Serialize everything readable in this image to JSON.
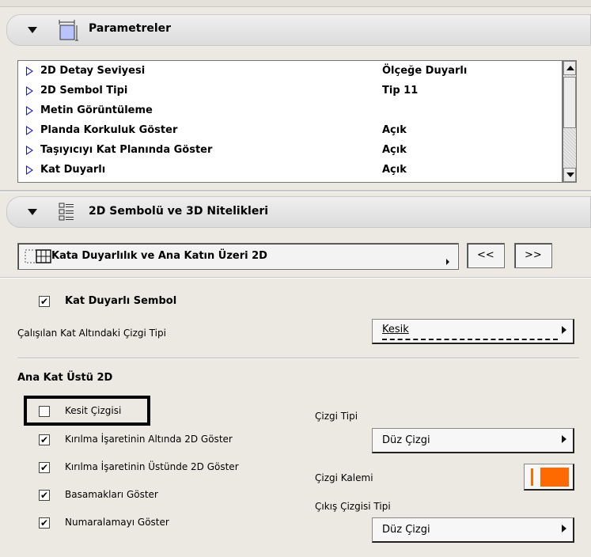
{
  "params_section": {
    "title": "Parametreler"
  },
  "param_list": [
    {
      "name": "2D Detay Seviyesi",
      "value": "Ölçeğe Duyarlı"
    },
    {
      "name": "2D Sembol Tipi",
      "value": "Tip 11"
    },
    {
      "name": "Metin Görüntüleme",
      "value": ""
    },
    {
      "name": "Planda Korkuluk Göster",
      "value": "Açık"
    },
    {
      "name": "Taşıyıcıyı Kat Planında Göster",
      "value": "Açık"
    },
    {
      "name": "Kat Duyarlı",
      "value": "Açık"
    }
  ],
  "symbol_section": {
    "title": "2D Sembolü ve 3D Nitelikleri"
  },
  "page_selector": {
    "label": "Kata Duyarlılık ve Ana Katın Üzeri 2D",
    "prev_label": "<<",
    "next_label": ">>"
  },
  "kat_duyarli": {
    "label": "Kat Duyarlı Sembol",
    "checked": "✔"
  },
  "line_type_below": {
    "label": "Çalışılan Kat Altındaki Çizgi Tipi",
    "value": "Kesik"
  },
  "ana_kat": {
    "heading": "Ana Kat Üstü 2D",
    "options": [
      {
        "label": "Kesit Çizgisi",
        "checked": ""
      },
      {
        "label": "Kırılma İşaretinin Altında 2D Göster",
        "checked": "✔"
      },
      {
        "label": "Kırılma İşaretinin Üstünde 2D Göster",
        "checked": "✔"
      },
      {
        "label": "Basamakları Göster",
        "checked": "✔"
      },
      {
        "label": "Numaralamayı Göster",
        "checked": "✔"
      }
    ],
    "line_type_label": "Çizgi Tipi",
    "line_type_value": "Düz Çizgi",
    "pen_label": "Çizgi Kalemi",
    "pen_color": "#ff6a00",
    "exit_line_label": "Çıkış Çizgisi Tipi",
    "exit_line_value": "Düz Çizgi"
  }
}
